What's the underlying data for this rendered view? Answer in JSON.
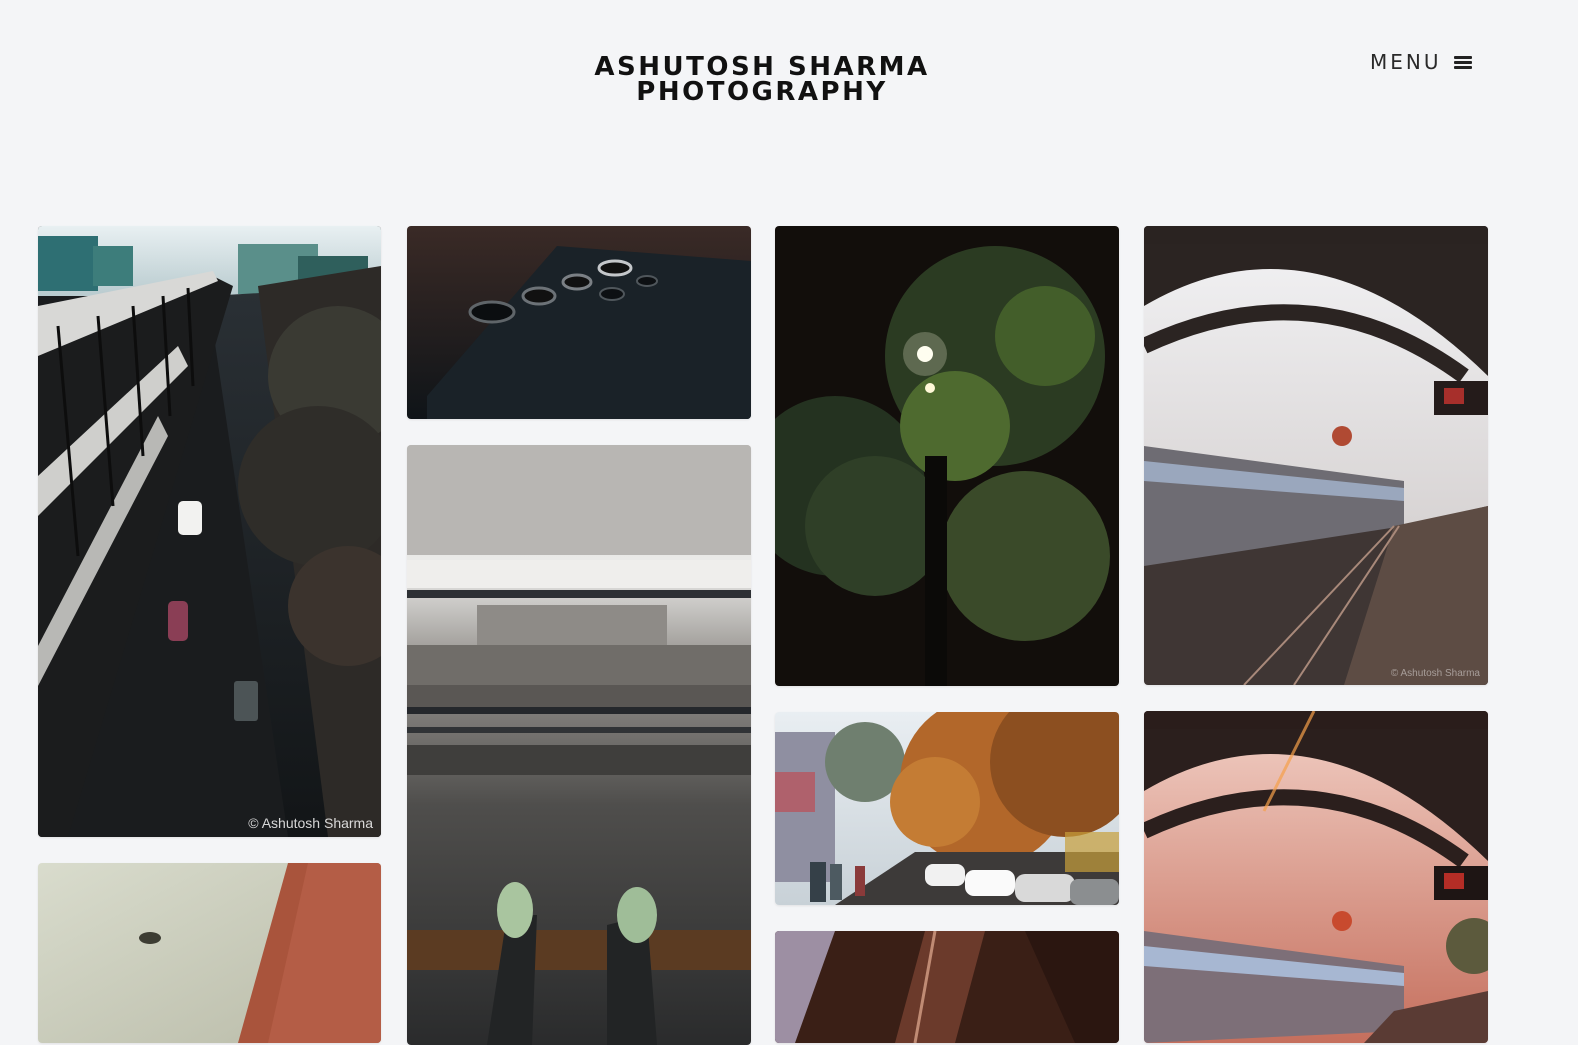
{
  "header": {
    "title_line1": "ASHUTOSH SHARMA",
    "title_line2": "PHOTOGRAPHY",
    "menu_label": "MENU",
    "menu_icon": "hamburger-icon"
  },
  "gallery": {
    "watermark": "© Ashutosh Sharma",
    "photos": [
      {
        "subject": "metro-railway-bridge-street"
      },
      {
        "subject": "phone-camera-closeup"
      },
      {
        "subject": "feet-over-railway-tracks"
      },
      {
        "subject": "tree-streetlight-night"
      },
      {
        "subject": "autumn-street-parked-cars"
      },
      {
        "subject": "metro-station-arch-train"
      },
      {
        "subject": "metro-station-arch-sunset"
      },
      {
        "subject": "ceiling-brick-blur"
      },
      {
        "subject": "train-interior"
      }
    ]
  },
  "colors": {
    "page_background": "#f4f5f7",
    "title_text": "#111111"
  }
}
